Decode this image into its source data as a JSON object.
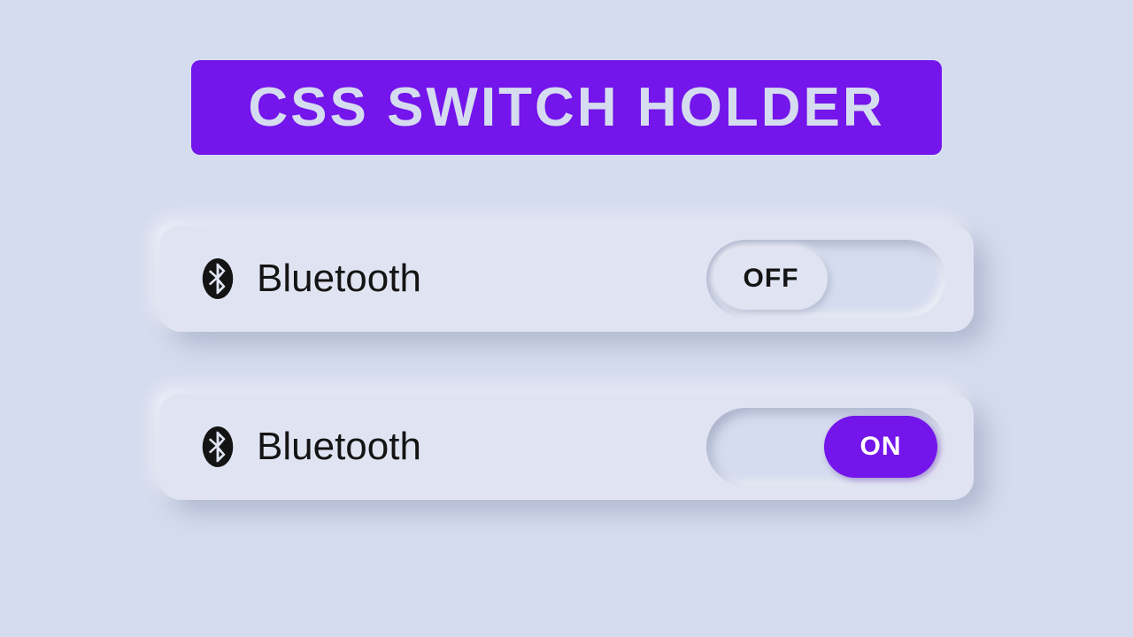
{
  "title": "CSS SWITCH HOLDER",
  "colors": {
    "accent": "#7315eb",
    "background": "#d6dcef",
    "card": "#e0e4f2"
  },
  "switches": [
    {
      "icon": "bluetooth-icon",
      "label": "Bluetooth",
      "state": "off",
      "state_label": "OFF"
    },
    {
      "icon": "bluetooth-icon",
      "label": "Bluetooth",
      "state": "on",
      "state_label": "ON"
    }
  ]
}
